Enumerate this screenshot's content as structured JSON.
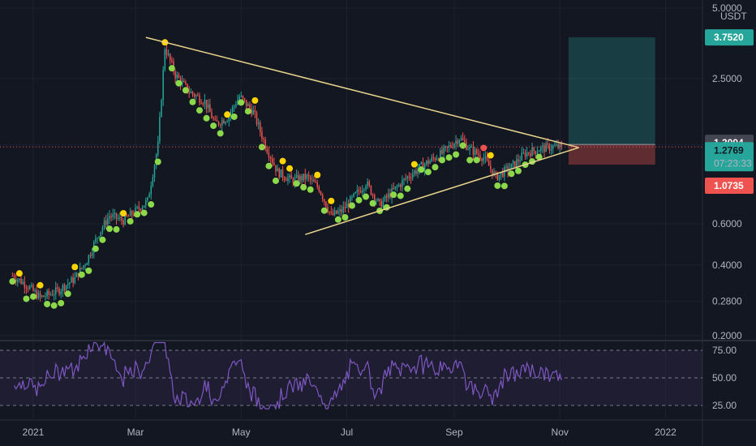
{
  "chart_data": {
    "type": "candlestick",
    "y_scale": "log",
    "quote_currency": "USDT",
    "price_ticks": [
      "5.0000",
      "2.5000",
      "1.3000",
      "0.6000",
      "0.4000",
      "0.2800",
      "0.2000"
    ],
    "price_tick_values": [
      5.0,
      2.5,
      1.3,
      0.6,
      0.4,
      0.28,
      0.2
    ],
    "x_ticks": [
      {
        "label": "2021",
        "date": "2021-01-01"
      },
      {
        "label": "Mar",
        "date": "2021-03-01"
      },
      {
        "label": "May",
        "date": "2021-05-01"
      },
      {
        "label": "Jul",
        "date": "2021-07-01"
      },
      {
        "label": "Sep",
        "date": "2021-09-01"
      },
      {
        "label": "Nov",
        "date": "2021-11-01"
      },
      {
        "label": "2022",
        "date": "2022-01-01"
      }
    ],
    "price_anchors": [
      [
        "2020-12-20",
        0.36
      ],
      [
        "2020-12-28",
        0.33
      ],
      [
        "2021-01-05",
        0.29
      ],
      [
        "2021-01-15",
        0.31
      ],
      [
        "2021-01-25",
        0.35
      ],
      [
        "2021-02-01",
        0.42
      ],
      [
        "2021-02-08",
        0.55
      ],
      [
        "2021-02-14",
        0.65
      ],
      [
        "2021-02-22",
        0.62
      ],
      [
        "2021-03-01",
        0.68
      ],
      [
        "2021-03-08",
        0.75
      ],
      [
        "2021-03-14",
        1.3
      ],
      [
        "2021-03-18",
        3.4
      ],
      [
        "2021-03-24",
        2.6
      ],
      [
        "2021-04-01",
        2.2
      ],
      [
        "2021-04-10",
        2.0
      ],
      [
        "2021-04-16",
        1.6
      ],
      [
        "2021-04-23",
        1.7
      ],
      [
        "2021-04-30",
        2.1
      ],
      [
        "2021-05-08",
        1.8
      ],
      [
        "2021-05-15",
        1.3
      ],
      [
        "2021-05-22",
        1.0
      ],
      [
        "2021-05-30",
        0.92
      ],
      [
        "2021-06-08",
        0.95
      ],
      [
        "2021-06-15",
        0.85
      ],
      [
        "2021-06-22",
        0.65
      ],
      [
        "2021-06-28",
        0.68
      ],
      [
        "2021-07-05",
        0.78
      ],
      [
        "2021-07-12",
        0.9
      ],
      [
        "2021-07-20",
        0.72
      ],
      [
        "2021-07-27",
        0.82
      ],
      [
        "2021-08-05",
        0.95
      ],
      [
        "2021-08-15",
        1.08
      ],
      [
        "2021-08-25",
        1.2
      ],
      [
        "2021-09-04",
        1.4
      ],
      [
        "2021-09-10",
        1.25
      ],
      [
        "2021-09-18",
        1.15
      ],
      [
        "2021-09-25",
        0.95
      ],
      [
        "2021-10-04",
        1.05
      ],
      [
        "2021-10-12",
        1.2
      ],
      [
        "2021-10-20",
        1.25
      ],
      [
        "2021-10-28",
        1.28
      ]
    ],
    "triangle_upper": {
      "from": {
        "date": "2021-03-07",
        "price": 3.75
      },
      "to": {
        "date": "2021-11-12",
        "price": 1.27
      }
    },
    "triangle_lower": {
      "from": {
        "date": "2021-06-07",
        "price": 0.54
      },
      "to": {
        "date": "2021-11-12",
        "price": 1.27
      }
    },
    "position": {
      "start_date": "2021-11-06",
      "end_date": "2021-12-26",
      "entry": 1.3094,
      "target": 3.752,
      "stop": 1.0735
    },
    "price_labels": {
      "target": "3.7520",
      "entry": "1.3094",
      "last": "1.2769",
      "countdown": "07:23:33",
      "stop": "1.0735"
    },
    "last_price": 1.2769,
    "rsi": {
      "levels": [
        "75.00",
        "50.00",
        "25.00"
      ],
      "level_values": [
        75,
        50,
        25
      ],
      "range": [
        25,
        75
      ]
    },
    "colors": {
      "background": "#131722",
      "up": "#26a69a",
      "down": "#ef5350",
      "trendline": "#e8d48a",
      "rsi_line": "#7e57c2",
      "target_zone": "rgba(38,166,154,0.28)",
      "stop_zone": "rgba(239,83,80,0.35)",
      "marker_green": "#8bd84b",
      "marker_yellow": "#ffd400",
      "marker_red": "#ef5350"
    }
  }
}
